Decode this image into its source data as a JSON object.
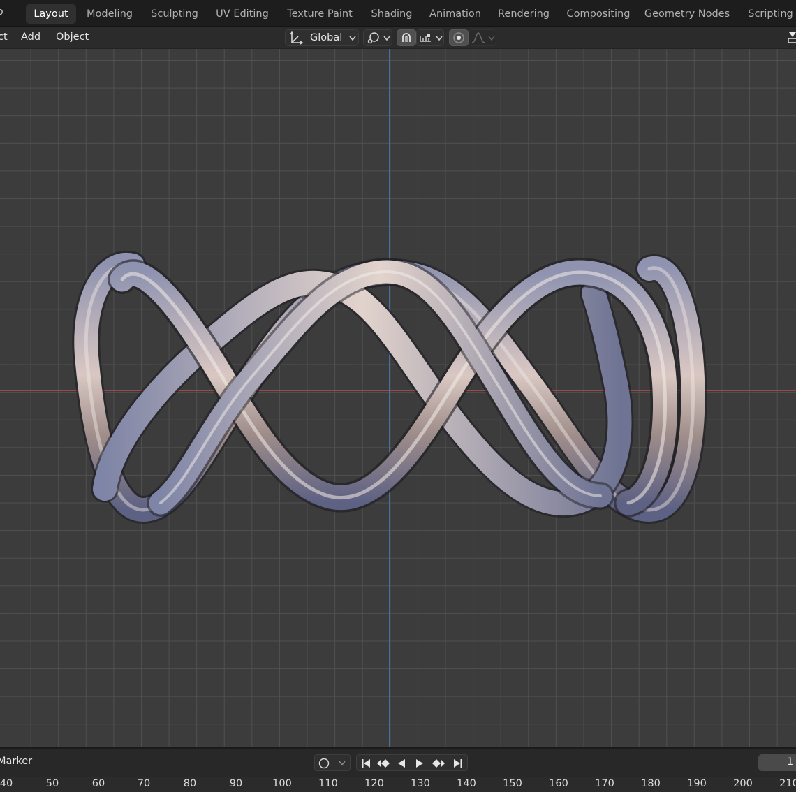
{
  "topbar": {
    "left_fragment": "o",
    "tabs": [
      {
        "label": "Layout",
        "active": true
      },
      {
        "label": "Modeling",
        "active": false
      },
      {
        "label": "Sculpting",
        "active": false
      },
      {
        "label": "UV Editing",
        "active": false
      },
      {
        "label": "Texture Paint",
        "active": false
      },
      {
        "label": "Shading",
        "active": false
      },
      {
        "label": "Animation",
        "active": false
      },
      {
        "label": "Rendering",
        "active": false
      },
      {
        "label": "Compositing",
        "active": false
      },
      {
        "label": "Geometry Nodes",
        "active": false
      },
      {
        "label": "Scripting",
        "active": false
      }
    ]
  },
  "header": {
    "menus": [
      "ct",
      "Add",
      "Object"
    ],
    "transform_orientation": "Global"
  },
  "colors": {
    "x_axis": "#9a4a4f",
    "y_axis": "#4a6fa3",
    "active_tab": "#303030",
    "toggle_active": "#505050"
  },
  "timeline": {
    "marker_menu": "Marker",
    "current_frame": "1",
    "ruler": [
      "40",
      "50",
      "60",
      "70",
      "80",
      "90",
      "100",
      "110",
      "120",
      "130",
      "140",
      "150",
      "160",
      "170",
      "180",
      "190",
      "200",
      "210"
    ]
  },
  "icons": {
    "transform_orientation": "transform-axes-icon",
    "pivot": "pivot-point-icon",
    "snap": "magnet-snap-icon",
    "snap_target": "snap-increment-icon",
    "proportional": "proportional-editing-icon",
    "falloff": "falloff-curve-icon",
    "autokey": "record-circle-icon",
    "jump_start": "jump-to-start-icon",
    "prev_key": "previous-keyframe-icon",
    "play_reverse": "play-reverse-icon",
    "play": "play-icon",
    "next_key": "next-keyframe-icon",
    "jump_end": "jump-to-end-icon"
  }
}
